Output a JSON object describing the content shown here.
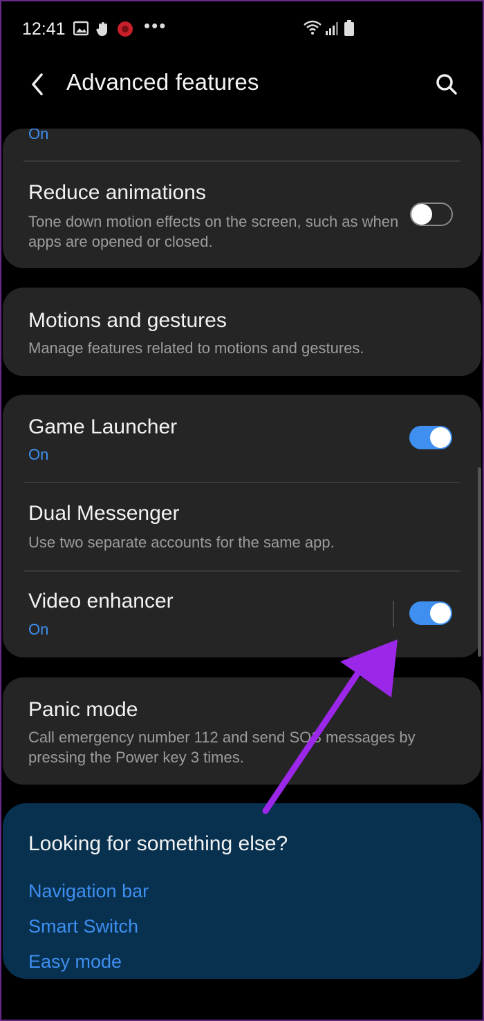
{
  "status_bar": {
    "time": "12:41",
    "left_icons": [
      "gallery-icon",
      "hand-icon",
      "bug-icon"
    ],
    "overflow": "•••",
    "right_icons": [
      "wifi-icon",
      "signal-icon",
      "battery-icon"
    ]
  },
  "app_bar": {
    "title": "Advanced features"
  },
  "sections": {
    "top_partial_status": "On",
    "reduce_animations": {
      "title": "Reduce animations",
      "subtitle": "Tone down motion effects on the screen, such as when apps are opened or closed.",
      "toggle": "off"
    },
    "motions_and_gestures": {
      "title": "Motions and gestures",
      "subtitle": "Manage features related to motions and gestures."
    },
    "game_launcher": {
      "title": "Game Launcher",
      "status": "On",
      "toggle": "on"
    },
    "dual_messenger": {
      "title": "Dual Messenger",
      "subtitle": "Use two separate accounts for the same app."
    },
    "video_enhancer": {
      "title": "Video enhancer",
      "status": "On",
      "toggle": "on"
    },
    "panic_mode": {
      "title": "Panic mode",
      "subtitle": "Call emergency number 112 and send SOS messages by pressing the Power key 3 times."
    }
  },
  "help": {
    "title": "Looking for something else?",
    "links": [
      "Navigation bar",
      "Smart Switch",
      "Easy mode"
    ]
  },
  "colors": {
    "background": "#000000",
    "card": "#252525",
    "accent": "#3e8ff0",
    "help_card": "#08304f",
    "annotation_arrow": "#9b27e8"
  }
}
